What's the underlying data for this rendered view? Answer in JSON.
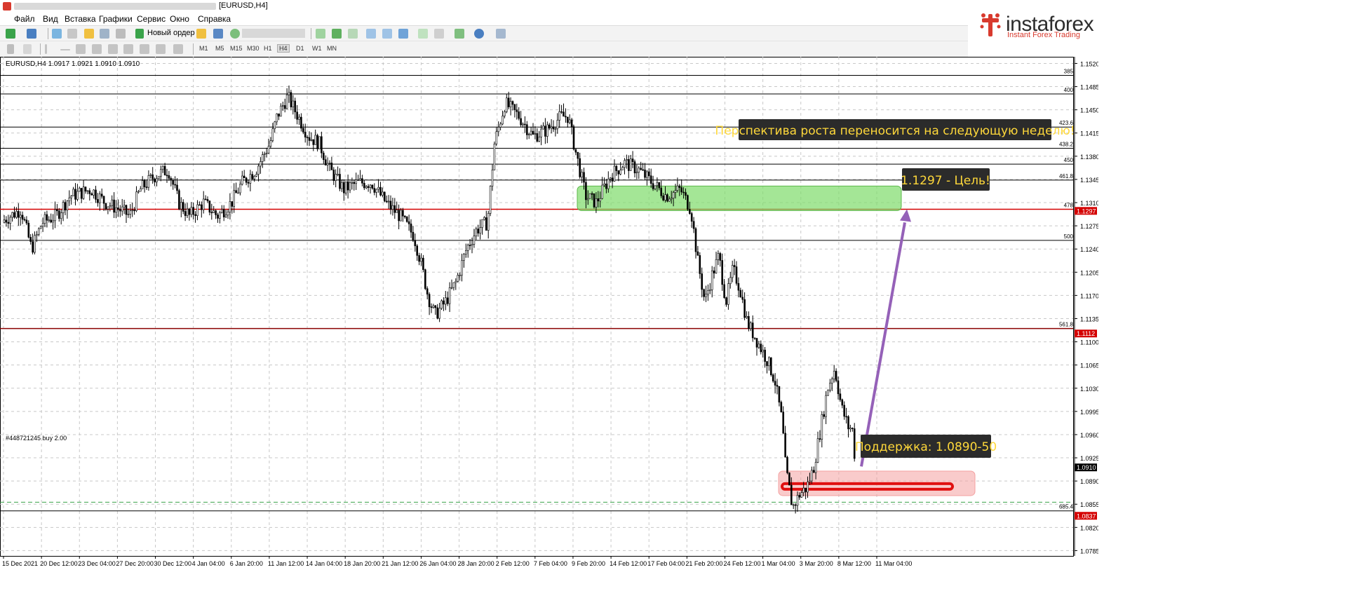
{
  "window": {
    "title": "[EURUSD,H4]"
  },
  "menu": [
    "Файл",
    "Вид",
    "Вставка",
    "Графики",
    "Сервис",
    "Окно",
    "Справка"
  ],
  "toolbar": {
    "new_order": "Новый ордер",
    "timeframes": [
      "M1",
      "M5",
      "M15",
      "M30",
      "H1",
      "H4",
      "D1",
      "W1",
      "MN"
    ],
    "active_timeframe": "H4"
  },
  "brand": {
    "name": "instaforex",
    "tagline": "Instant Forex Trading",
    "accent": "#d83a2e"
  },
  "chart_data": {
    "type": "candlestick",
    "symbol_header": "EURUSD,H4  1.0917 1.0921 1.0910 1.0910",
    "position_label": "#448721245 buy 2.00",
    "price_ticks": [
      "1.1520",
      "1.1485",
      "1.1450",
      "1.1415",
      "1.1380",
      "1.1345",
      "1.1310",
      "1.1275",
      "1.1240",
      "1.1205",
      "1.1170",
      "1.1135",
      "1.1100",
      "1.1065",
      "1.1030",
      "1.0995",
      "1.0960",
      "1.0925",
      "1.0890",
      "1.0855",
      "1.0820",
      "1.0785"
    ],
    "price_range": [
      1.0777,
      1.153
    ],
    "date_ticks": [
      "15 Dec 2021",
      "20 Dec 12:00",
      "23 Dec 04:00",
      "27 Dec 20:00",
      "30 Dec 12:00",
      "4 Jan 04:00",
      "6 Jan 20:00",
      "11 Jan 12:00",
      "14 Jan 04:00",
      "18 Jan 20:00",
      "21 Jan 12:00",
      "26 Jan 04:00",
      "28 Jan 20:00",
      "2 Feb 12:00",
      "7 Feb 04:00",
      "9 Feb 20:00",
      "14 Feb 12:00",
      "17 Feb 04:00",
      "21 Feb 20:00",
      "24 Feb 12:00",
      "1 Mar 04:00",
      "3 Mar 20:00",
      "8 Mar 12:00",
      "11 Mar 04:00"
    ],
    "fib_levels": [
      {
        "label": "385",
        "price": 1.1502,
        "color": "#000000"
      },
      {
        "label": "400",
        "price": 1.1474,
        "color": "#000000"
      },
      {
        "label": "423.6",
        "price": 1.1424,
        "color": "#000000"
      },
      {
        "label": "438.2",
        "price": 1.1392,
        "color": "#000000"
      },
      {
        "label": "450",
        "price": 1.1368,
        "color": "#000000"
      },
      {
        "label": "461.8",
        "price": 1.1344,
        "color": "#000000"
      },
      {
        "label": "478",
        "price": 1.13,
        "color": "#d40000"
      },
      {
        "label": "500",
        "price": 1.1253,
        "color": "#000000"
      },
      {
        "label": "561.8",
        "price": 1.112,
        "color": "#8a0000"
      },
      {
        "label": "685.4",
        "price": 1.0845,
        "color": "#000000"
      }
    ],
    "price_tags": [
      {
        "text": "1.1297",
        "price": 1.1297,
        "color": "#d40000"
      },
      {
        "text": "1.1112",
        "price": 1.1112,
        "color": "#d40000"
      },
      {
        "text": "1.0910",
        "price": 1.091,
        "color": "#000000"
      },
      {
        "text": "1.0837",
        "price": 1.0837,
        "color": "#d40000"
      }
    ],
    "close_path": [
      [
        0,
        1.128
      ],
      [
        30,
        1.13
      ],
      [
        45,
        1.124
      ],
      [
        60,
        1.128
      ],
      [
        80,
        1.129
      ],
      [
        100,
        1.132
      ],
      [
        130,
        1.133
      ],
      [
        150,
        1.131
      ],
      [
        170,
        1.13
      ],
      [
        185,
        1.129
      ],
      [
        200,
        1.133
      ],
      [
        220,
        1.135
      ],
      [
        240,
        1.136
      ],
      [
        255,
        1.131
      ],
      [
        270,
        1.129
      ],
      [
        290,
        1.131
      ],
      [
        310,
        1.129
      ],
      [
        330,
        1.131
      ],
      [
        345,
        1.134
      ],
      [
        365,
        1.136
      ],
      [
        385,
        1.14
      ],
      [
        395,
        1.144
      ],
      [
        410,
        1.147
      ],
      [
        425,
        1.144
      ],
      [
        440,
        1.141
      ],
      [
        455,
        1.14
      ],
      [
        470,
        1.136
      ],
      [
        490,
        1.133
      ],
      [
        510,
        1.134
      ],
      [
        530,
        1.134
      ],
      [
        550,
        1.131
      ],
      [
        570,
        1.129
      ],
      [
        590,
        1.126
      ],
      [
        600,
        1.122
      ],
      [
        610,
        1.117
      ],
      [
        620,
        1.114
      ],
      [
        635,
        1.116
      ],
      [
        650,
        1.119
      ],
      [
        665,
        1.124
      ],
      [
        680,
        1.127
      ],
      [
        695,
        1.128
      ],
      [
        705,
        1.14
      ],
      [
        720,
        1.146
      ],
      [
        740,
        1.144
      ],
      [
        760,
        1.141
      ],
      [
        780,
        1.142
      ],
      [
        800,
        1.144
      ],
      [
        810,
        1.144
      ],
      [
        820,
        1.139
      ],
      [
        835,
        1.132
      ],
      [
        850,
        1.131
      ],
      [
        870,
        1.135
      ],
      [
        890,
        1.137
      ],
      [
        910,
        1.136
      ],
      [
        930,
        1.134
      ],
      [
        950,
        1.132
      ],
      [
        970,
        1.133
      ],
      [
        985,
        1.13
      ],
      [
        995,
        1.122
      ],
      [
        1005,
        1.116
      ],
      [
        1015,
        1.12
      ],
      [
        1025,
        1.123
      ],
      [
        1035,
        1.116
      ],
      [
        1045,
        1.121
      ],
      [
        1055,
        1.118
      ],
      [
        1065,
        1.113
      ],
      [
        1080,
        1.11
      ],
      [
        1095,
        1.107
      ],
      [
        1105,
        1.104
      ],
      [
        1115,
        1.098
      ],
      [
        1120,
        1.091
      ],
      [
        1130,
        1.085
      ],
      [
        1140,
        1.087
      ],
      [
        1150,
        1.088
      ],
      [
        1160,
        1.091
      ],
      [
        1170,
        1.097
      ],
      [
        1180,
        1.103
      ],
      [
        1190,
        1.106
      ],
      [
        1200,
        1.1
      ],
      [
        1210,
        1.097
      ],
      [
        1215,
        1.097
      ],
      [
        1220,
        1.091
      ]
    ],
    "annotations": {
      "headline": "Перспектива роста переносится на следующую неделю!",
      "target": "1.1297 - Цель!",
      "support": "Поддержка: 1.0890-50",
      "colors": {
        "target_zone": "#7ddc6a",
        "support_zone": "#f4a0a0",
        "arrow": "#9561b8",
        "callout_bg": "#2b2b2b",
        "callout_text": "#ffd83a"
      }
    }
  }
}
